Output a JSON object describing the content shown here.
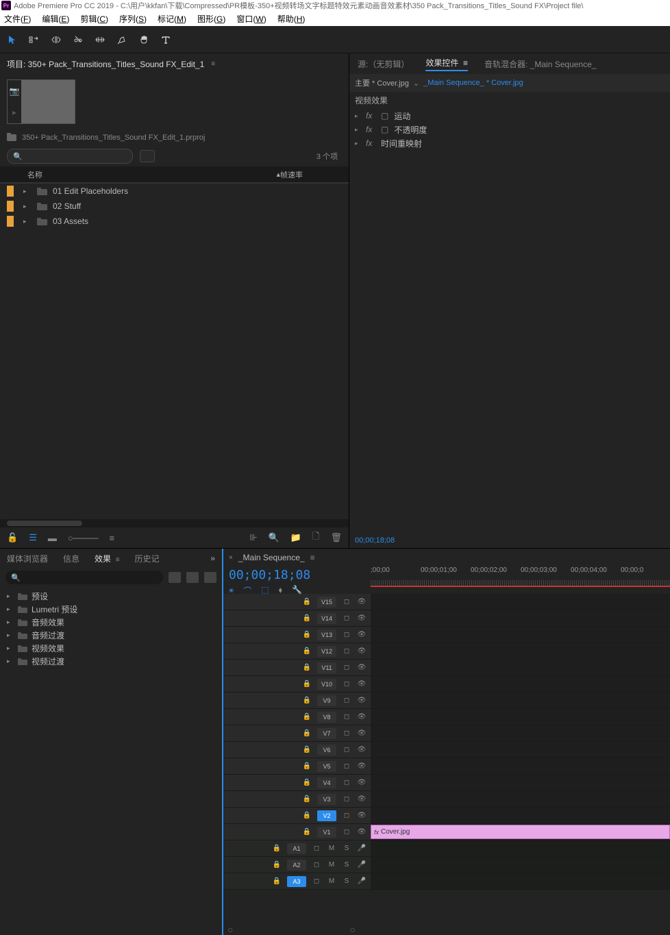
{
  "title": "Adobe Premiere Pro CC 2019 - C:\\用户\\kkfan\\下载\\Compressed\\PR模板-350+视频转场文字标题特效元素动画音效素材\\350 Pack_Transitions_Titles_Sound FX\\Project file\\",
  "menubar": [
    "文件(F)",
    "编辑(E)",
    "剪辑(C)",
    "序列(S)",
    "标记(M)",
    "图形(G)",
    "窗口(W)",
    "帮助(H)"
  ],
  "project": {
    "tab_label": "项目: 350+ Pack_Transitions_Titles_Sound FX_Edit_1",
    "path": "350+ Pack_Transitions_Titles_Sound FX_Edit_1.prproj",
    "item_count": "3 个项",
    "columns": {
      "name": "名称",
      "fps": "帧速率"
    },
    "items": [
      {
        "name": "01 Edit Placeholders"
      },
      {
        "name": "02 Stuff"
      },
      {
        "name": "03 Assets"
      }
    ]
  },
  "source_tabs": {
    "source": "源:（无剪辑）",
    "effect_controls": "效果控件",
    "audio_mixer": "音轨混合器: _Main Sequence_"
  },
  "effect_controls": {
    "master": "主要 * Cover.jpg",
    "link": "_Main Sequence_ * Cover.jpg",
    "section": "视频效果",
    "rows": [
      "运动",
      "不透明度",
      "时间重映射"
    ],
    "footer_tc": "00;00;18;08"
  },
  "effects_panel": {
    "tabs": [
      "媒体浏览器",
      "信息",
      "效果",
      "历史记"
    ],
    "active_tab": "效果",
    "tree": [
      "预设",
      "Lumetri 预设",
      "音频效果",
      "音频过渡",
      "视频效果",
      "视频过渡"
    ]
  },
  "timeline": {
    "sequence_name": "_Main Sequence_",
    "timecode": "00;00;18;08",
    "ruler_labels": [
      ";00;00",
      "00;00;01;00",
      "00;00;02;00",
      "00;00;03;00",
      "00;00;04;00",
      "00;00;0"
    ],
    "video_tracks": [
      "V15",
      "V14",
      "V13",
      "V12",
      "V11",
      "V10",
      "V9",
      "V8",
      "V7",
      "V6",
      "V5",
      "V4",
      "V3",
      "V2",
      "V1"
    ],
    "selected_video": "V2",
    "audio_tracks": [
      "A1",
      "A2",
      "A3"
    ],
    "selected_audio": "A3",
    "clip": {
      "track": "V1",
      "name": "Cover.jpg"
    },
    "audio_btns": [
      "M",
      "S"
    ]
  }
}
